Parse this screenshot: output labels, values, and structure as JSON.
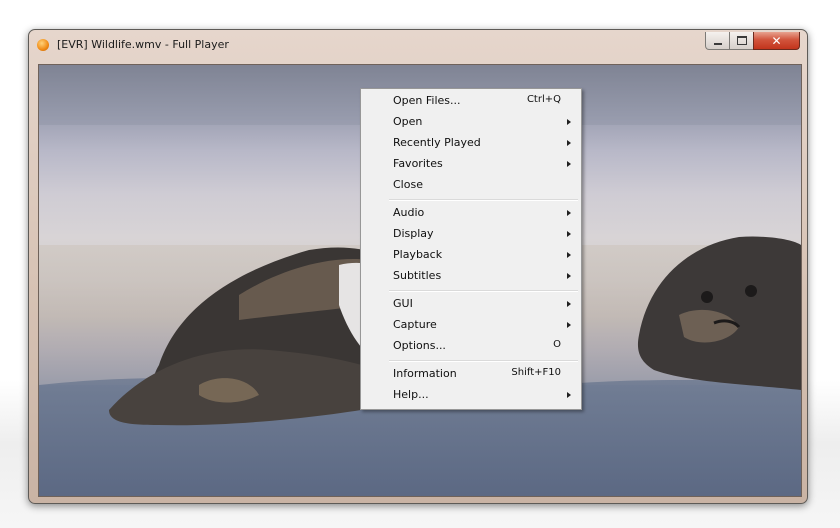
{
  "window": {
    "title": "[EVR] Wildlife.wmv - Full Player",
    "icon": "player-orange-icon",
    "controls": {
      "minimize": "minimize-icon",
      "maximize": "maximize-icon",
      "close": "close-icon",
      "close_glyph": "✕"
    }
  },
  "video": {
    "subject": "seal-video-frame"
  },
  "menu": {
    "groups": [
      [
        {
          "label": "Open Files...",
          "shortcut": "Ctrl+Q",
          "submenu": false
        },
        {
          "label": "Open",
          "shortcut": "",
          "submenu": true
        },
        {
          "label": "Recently Played",
          "shortcut": "",
          "submenu": true
        },
        {
          "label": "Favorites",
          "shortcut": "",
          "submenu": true
        },
        {
          "label": "Close",
          "shortcut": "",
          "submenu": false
        }
      ],
      [
        {
          "label": "Audio",
          "shortcut": "",
          "submenu": true
        },
        {
          "label": "Display",
          "shortcut": "",
          "submenu": true
        },
        {
          "label": "Playback",
          "shortcut": "",
          "submenu": true
        },
        {
          "label": "Subtitles",
          "shortcut": "",
          "submenu": true
        }
      ],
      [
        {
          "label": "GUI",
          "shortcut": "",
          "submenu": true
        },
        {
          "label": "Capture",
          "shortcut": "",
          "submenu": true
        },
        {
          "label": "Options...",
          "shortcut": "O",
          "submenu": false
        }
      ],
      [
        {
          "label": "Information",
          "shortcut": "Shift+F10",
          "submenu": false
        },
        {
          "label": "Help...",
          "shortcut": "",
          "submenu": true
        }
      ]
    ]
  },
  "colors": {
    "close_button": "#c2341c",
    "menu_bg": "#f0f0f0",
    "frame": "#d8c4b6"
  }
}
